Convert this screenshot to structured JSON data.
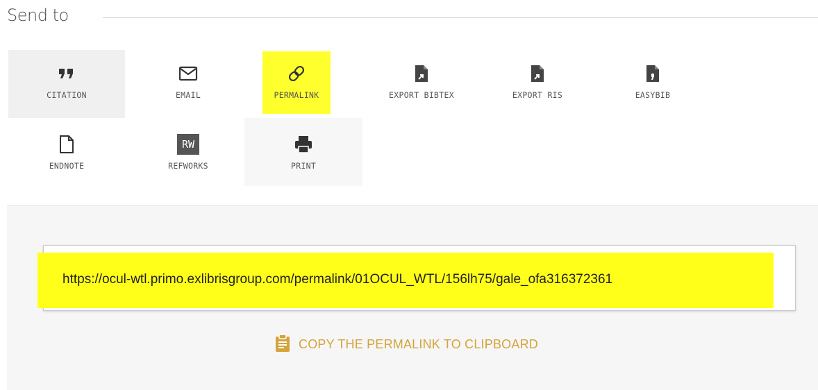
{
  "header": {
    "title": "Send to"
  },
  "actions": [
    {
      "label": "CITATION",
      "icon": "quote-icon"
    },
    {
      "label": "EMAIL",
      "icon": "envelope-icon"
    },
    {
      "label": "PERMALINK",
      "icon": "link-icon"
    },
    {
      "label": "EXPORT BIBTEX",
      "icon": "file-export-icon"
    },
    {
      "label": "EXPORT RIS",
      "icon": "file-export-icon"
    },
    {
      "label": "EASYBIB",
      "icon": "file-quote-icon"
    },
    {
      "label": "ENDNOTE",
      "icon": "document-icon"
    },
    {
      "label": "REFWORKS",
      "icon": "refworks-icon",
      "badge": "RW"
    },
    {
      "label": "PRINT",
      "icon": "printer-icon"
    }
  ],
  "permalink": {
    "url": "https://ocul-wtl.primo.exlibrisgroup.com/permalink/01OCUL_WTL/156lh75/gale_ofa316372361",
    "copy_label": "COPY THE PERMALINK TO CLIPBOARD"
  },
  "colors": {
    "highlight": "#ffff2e",
    "accent": "#d4a43a"
  }
}
